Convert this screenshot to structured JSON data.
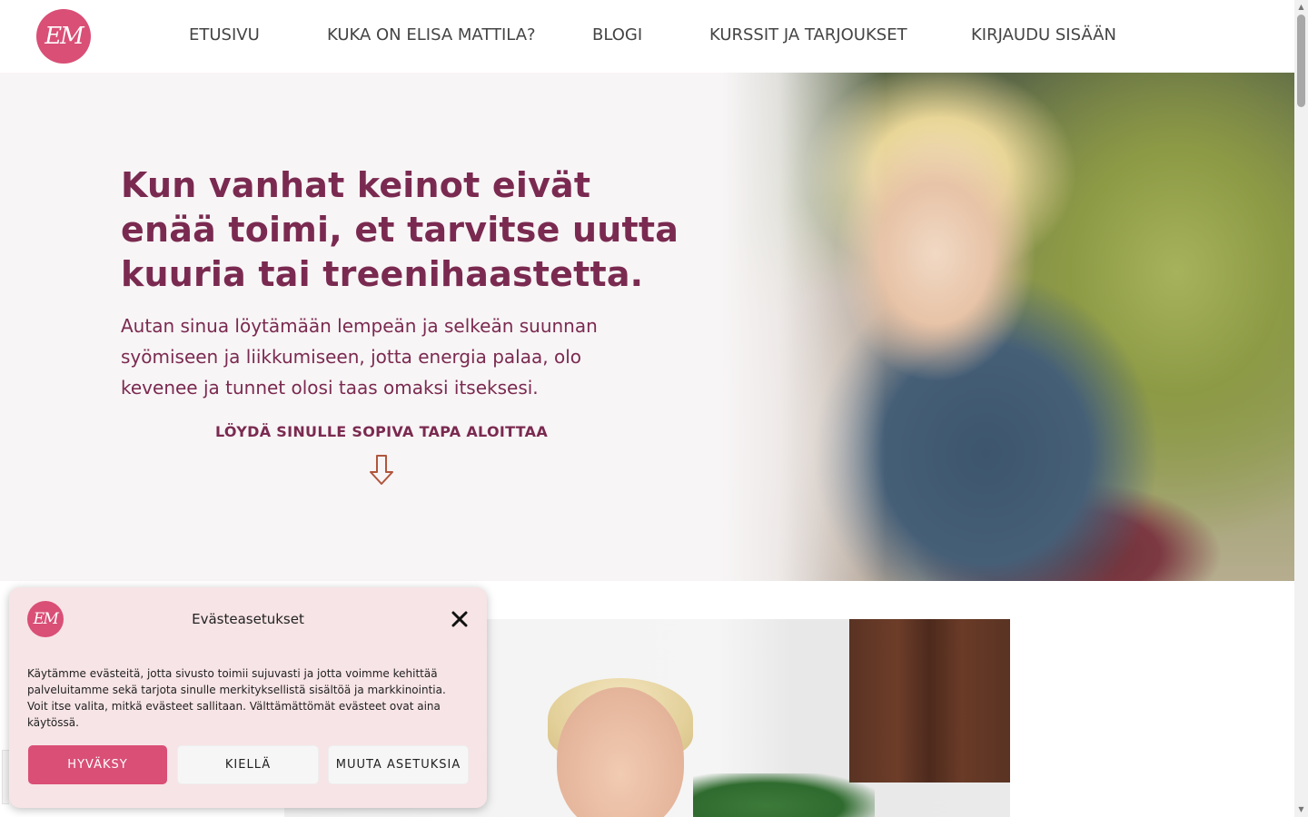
{
  "brand": {
    "logo_text": "EM",
    "accent_color": "#d94f76",
    "heading_color": "#7a2a50"
  },
  "nav": {
    "items": [
      {
        "label": "ETUSIVU"
      },
      {
        "label": "KUKA ON ELISA MATTILA?"
      },
      {
        "label": "BLOGI"
      },
      {
        "label": "KURSSIT JA TARJOUKSET"
      },
      {
        "label": "KIRJAUDU SISÄÄN"
      }
    ]
  },
  "hero": {
    "title": "Kun vanhat keinot eivät enää toimi, et tarvitse uutta kuuria tai treenihaastetta.",
    "subtitle": "Autan sinua löytämään lempeän ja selkeän suunnan syömiseen ja liikkumiseen, jotta energia palaa, olo kevenee ja tunnet olosi taas omaksi itseksesi.",
    "cta": "LÖYDÄ SINULLE SOPIVA TAPA ALOITTAA",
    "cta_icon": "arrow-down-icon"
  },
  "cookie": {
    "logo_text": "EM",
    "title": "Evästeasetukset",
    "text_line1": "Käytämme evästeitä, jotta sivusto toimii sujuvasti ja jotta voimme kehittää palveluitamme sekä tarjota sinulle merkityksellistä sisältöä ja markkinointia.",
    "text_line2": "Voit itse valita, mitkä evästeet sallitaan. Välttämättömät evästeet ovat aina käytössä.",
    "accept_label": "HYVÄKSY",
    "deny_label": "KIELLÄ",
    "settings_label": "MUUTA ASETUKSIA"
  }
}
